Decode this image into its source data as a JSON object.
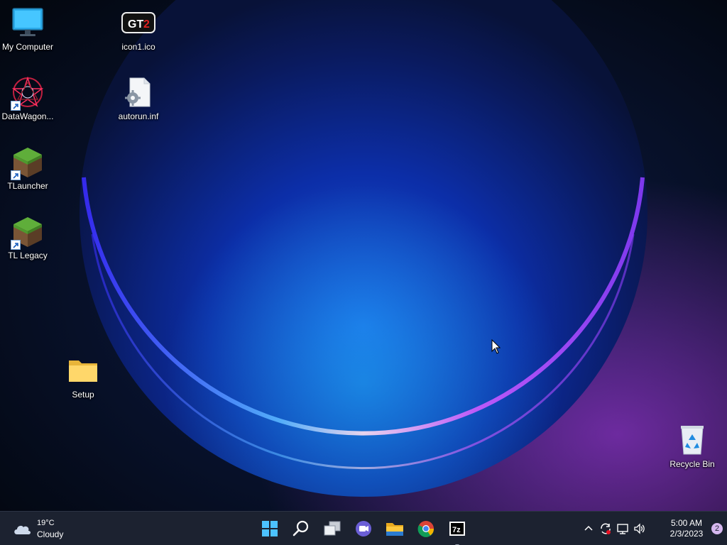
{
  "desktop": {
    "icons": {
      "my_computer": {
        "label": "My Computer",
        "icon": "monitor-icon"
      },
      "icon1": {
        "label": "icon1.ico",
        "icon": "gta2-logo-icon"
      },
      "datawagon": {
        "label": "DataWagon...",
        "icon": "datawagon-icon"
      },
      "autorun": {
        "label": "autorun.inf",
        "icon": "settings-file-icon"
      },
      "tlauncher": {
        "label": "TLauncher",
        "icon": "grass-block-icon"
      },
      "tl_legacy": {
        "label": "TL Legacy",
        "icon": "grass-block-icon"
      },
      "setup": {
        "label": "Setup",
        "icon": "folder-icon"
      },
      "recycle_bin": {
        "label": "Recycle Bin",
        "icon": "recycle-bin-icon"
      }
    }
  },
  "taskbar": {
    "weather": {
      "temperature": "19°C",
      "condition": "Cloudy",
      "icon": "cloud-icon"
    },
    "apps": [
      {
        "name": "Start",
        "icon": "windows-start-icon"
      },
      {
        "name": "Search",
        "icon": "search-icon"
      },
      {
        "name": "Task View",
        "icon": "task-view-icon"
      },
      {
        "name": "Chat",
        "icon": "teams-chat-icon"
      },
      {
        "name": "File Explorer",
        "icon": "file-explorer-icon"
      },
      {
        "name": "Google Chrome",
        "icon": "chrome-icon"
      },
      {
        "name": "7-Zip",
        "icon": "seven-zip-icon",
        "running": true
      }
    ],
    "tray": {
      "icons": [
        "chevron-up-icon",
        "sync-icon",
        "network-icon",
        "volume-icon"
      ],
      "time": "5:00 AM",
      "date": "2/3/2023",
      "notifications": "2"
    }
  },
  "colors": {
    "taskbar_bg": "#1c2230",
    "accent_blue": "#3aa0ff",
    "wallpaper_glow": "#6a2cf0"
  }
}
